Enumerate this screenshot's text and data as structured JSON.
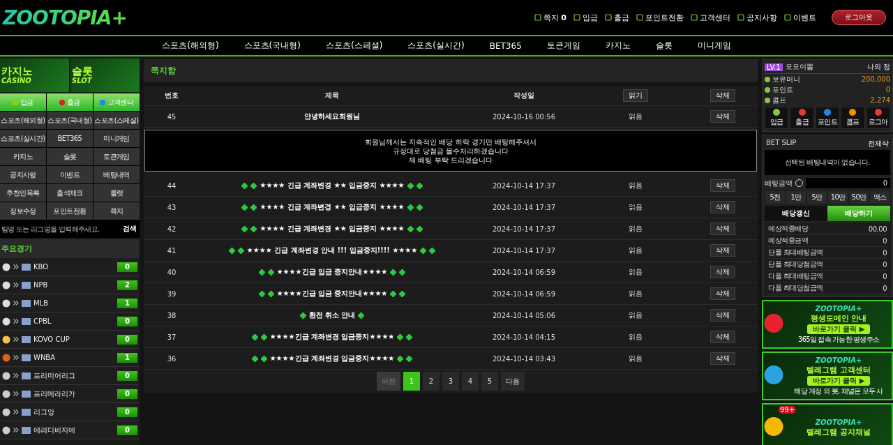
{
  "header": {
    "logo": "ZOOTOPIA+",
    "links": [
      {
        "label": "쪽지",
        "count": "0"
      },
      {
        "label": "입금"
      },
      {
        "label": "출금"
      },
      {
        "label": "포인트전환"
      },
      {
        "label": "고객센터"
      },
      {
        "label": "공지사항"
      },
      {
        "label": "이벤트"
      }
    ],
    "logout": "로그아웃"
  },
  "nav": [
    "스포츠(해외형)",
    "스포츠(국내형)",
    "스포츠(스페셜)",
    "스포츠(실시간)",
    "BET365",
    "토큰게임",
    "카지노",
    "슬롯",
    "미니게임"
  ],
  "left": {
    "banners": [
      {
        "title": "카지노",
        "subtitle": "CASINO"
      },
      {
        "title": "슬롯",
        "subtitle": "SLOT"
      }
    ],
    "quick": [
      {
        "label": "입금",
        "kind": "deposit"
      },
      {
        "label": "출금",
        "kind": "withdraw"
      },
      {
        "label": "고객센터",
        "kind": "help"
      }
    ],
    "menu": [
      "스포츠(해외형)",
      "스포츠(국내형)",
      "스포츠(스페셜)",
      "스포츠(실시간)",
      "BET365",
      "미니게임",
      "카지노",
      "슬롯",
      "토큰게임",
      "공지사항",
      "이벤트",
      "배팅내역",
      "추천인목록",
      "출석체크",
      "룰렛",
      "정보수정",
      "포인트전환",
      "쪽지"
    ],
    "search": {
      "placeholder": "팀명 또는 리그명을 입력해주세요.",
      "button": "검색"
    },
    "featured_title": "주요경기",
    "leagues": [
      {
        "name": "KBO",
        "kind": "baseball",
        "count": "0"
      },
      {
        "name": "NPB",
        "kind": "baseball",
        "count": "2"
      },
      {
        "name": "MLB",
        "kind": "baseball",
        "count": "1"
      },
      {
        "name": "CPBL",
        "kind": "baseball",
        "count": "0"
      },
      {
        "name": "KOVO CUP",
        "kind": "volleyball",
        "count": "0"
      },
      {
        "name": "WNBA",
        "kind": "basketball",
        "count": "1"
      },
      {
        "name": "프리미어리그",
        "kind": "soccer",
        "count": "0"
      },
      {
        "name": "프리메라리가",
        "kind": "soccer",
        "count": "0"
      },
      {
        "name": "리그앙",
        "kind": "soccer",
        "count": "0"
      },
      {
        "name": "에레디비지에",
        "kind": "soccer",
        "count": "0"
      }
    ]
  },
  "main": {
    "title": "쪽지함",
    "columns": [
      "번호",
      "제목",
      "작성일",
      "읽기",
      "삭제"
    ],
    "rows": [
      {
        "no": "45",
        "title": "안녕하세요회원님",
        "kind": "plain",
        "date": "2024-10-16 00:56",
        "status": "읽음",
        "delete": "삭제",
        "body": [
          "회원님께서는 지속적인 배당 하락 경기만 배팅해주셔서",
          "규정대로 당첨금 몰수처리하겠습니다",
          "재 배팅 부탁 드리겠습니다"
        ]
      },
      {
        "no": "44",
        "title": "★★★★ 긴급 계좌변경 ★★ 입금중지 ★★★★",
        "kind": "double",
        "date": "2024-10-14 17:37",
        "status": "읽음",
        "delete": "삭제"
      },
      {
        "no": "43",
        "title": "★★★★ 긴급 계좌변경 ★★ 입금중지 ★★★★",
        "kind": "double",
        "date": "2024-10-14 17:37",
        "status": "읽음",
        "delete": "삭제"
      },
      {
        "no": "42",
        "title": "★★★★ 긴급 계좌변경 ★★ 입금중지 ★★★★",
        "kind": "double",
        "date": "2024-10-14 17:37",
        "status": "읽음",
        "delete": "삭제"
      },
      {
        "no": "41",
        "title": "★★★★ 긴급 계좌변경 안내 !!! 입금중지!!!! ★★★★",
        "kind": "double",
        "date": "2024-10-14 17:37",
        "status": "읽음",
        "delete": "삭제"
      },
      {
        "no": "40",
        "title": "★★★★긴급 입금 중지안내★★★★",
        "kind": "double",
        "date": "2024-10-14 06:59",
        "status": "읽음",
        "delete": "삭제"
      },
      {
        "no": "39",
        "title": "★★★★긴급 입금 중지안내★★★★",
        "kind": "double",
        "date": "2024-10-14 06:59",
        "status": "읽음",
        "delete": "삭제"
      },
      {
        "no": "38",
        "title": "환전 취소 안내",
        "kind": "single",
        "date": "2024-10-14 05:06",
        "status": "읽음",
        "delete": "삭제"
      },
      {
        "no": "37",
        "title": "★★★★긴급 계좌변경 입금중지★★★★",
        "kind": "double",
        "date": "2024-10-14 04:15",
        "status": "읽음",
        "delete": "삭제"
      },
      {
        "no": "36",
        "title": "★★★★긴급 계좌변경 입금중지★★★★",
        "kind": "double",
        "date": "2024-10-14 03:43",
        "status": "읽음",
        "delete": "삭제"
      }
    ],
    "pagination": {
      "prev": {
        "label": "이전",
        "disabled": true
      },
      "pages": [
        {
          "label": "1",
          "selected": true
        },
        {
          "label": "2",
          "selected": false
        },
        {
          "label": "3",
          "selected": false
        },
        {
          "label": "4",
          "selected": false
        },
        {
          "label": "5",
          "selected": false
        }
      ],
      "next": {
        "label": "다음",
        "disabled": false
      }
    }
  },
  "right": {
    "level": "LV.1",
    "nickname": "모모이뽑",
    "my_info": "나의 정",
    "balances": [
      {
        "label": "보유머니",
        "value": "200,000"
      },
      {
        "label": "포인트",
        "value": "0"
      },
      {
        "label": "콤프",
        "value": "2,274"
      }
    ],
    "actions": [
      {
        "label": "입금",
        "kind": "plus"
      },
      {
        "label": "출금",
        "kind": "minus"
      },
      {
        "label": "포인트",
        "kind": "point"
      },
      {
        "label": "콤프",
        "kind": "comp"
      },
      {
        "label": "로그아",
        "kind": "logout"
      }
    ],
    "betslip": {
      "title": "BET SLIP",
      "clear": "전체삭",
      "empty": "선택된 배팅내역이 없습니다.",
      "amount_label": "배팅금액",
      "amount": "0",
      "chips": [
        "5천",
        "1만",
        "5만",
        "10만",
        "50만",
        "맥스"
      ],
      "refresh": "배당갱신",
      "bet": "배당하기",
      "summary": [
        {
          "label": "예상적중배당",
          "value": "00.00"
        },
        {
          "label": "예상적중금액",
          "value": "0"
        },
        {
          "label": "단폴 최대배팅금액",
          "value": "0"
        },
        {
          "label": "단폴 최대당첨금액",
          "value": "0"
        },
        {
          "label": "다폴 최대배팅금액",
          "value": "0"
        },
        {
          "label": "다폴 최대당첨금액",
          "value": "0"
        }
      ]
    },
    "promos": [
      {
        "brand": "ZOOTOPIA+",
        "title": "평생도메인 안내",
        "button": "바로가기 클릭 ▶",
        "note": "365일 접속 가능한 평생주소",
        "kind": "pin"
      },
      {
        "brand": "ZOOTOPIA+",
        "title": "텔레그램 고객센터",
        "button": "바로가기 클릭 ▶",
        "note": "해당 계정 외 봇, 채널은 모두 사",
        "kind": "telegram"
      },
      {
        "brand": "ZOOTOPIA+",
        "title": "텔레그램 공지채널",
        "kind": "bell",
        "badge": "99+"
      }
    ]
  }
}
